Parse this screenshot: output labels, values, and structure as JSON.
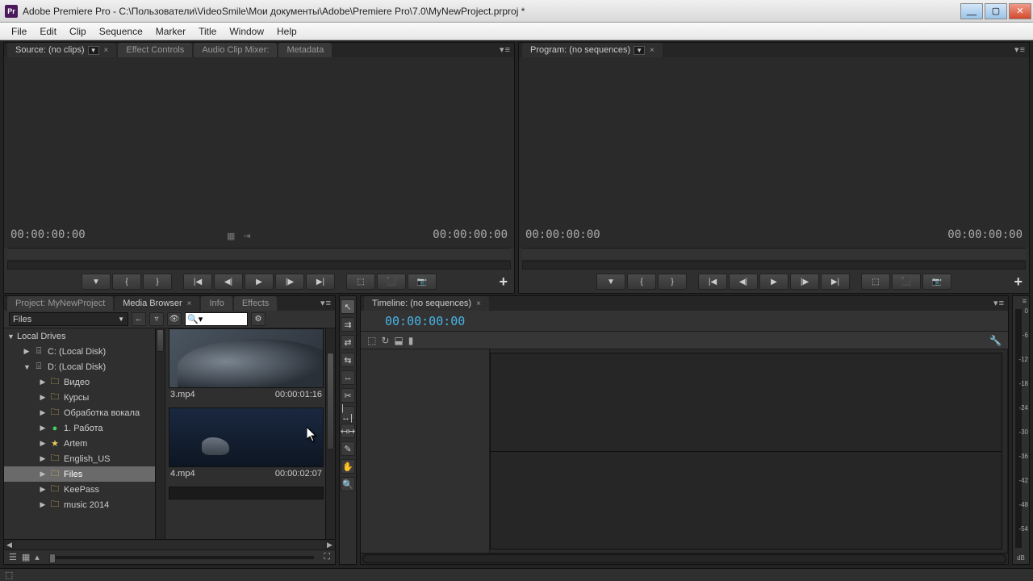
{
  "titlebar": {
    "app_icon": "Pr",
    "title": "Adobe Premiere Pro - C:\\Пользователи\\VideoSmile\\Мои документы\\Adobe\\Premiere Pro\\7.0\\MyNewProject.prproj *"
  },
  "menubar": [
    "File",
    "Edit",
    "Clip",
    "Sequence",
    "Marker",
    "Title",
    "Window",
    "Help"
  ],
  "source_panel": {
    "tabs": {
      "source": "Source: (no clips)",
      "effect_controls": "Effect Controls",
      "audio_mixer": "Audio Clip Mixer:",
      "metadata": "Metadata"
    },
    "time_left": "00:00:00:00",
    "time_right": "00:00:00:00"
  },
  "program_panel": {
    "tab": "Program: (no sequences)",
    "time_left": "00:00:00:00",
    "time_right": "00:00:00:00"
  },
  "project_panel": {
    "tabs": {
      "project": "Project: MyNewProject",
      "media_browser": "Media Browser",
      "info": "Info",
      "effects": "Effects"
    },
    "dropdown": "Files",
    "tree_root": "Local Drives",
    "tree_items": [
      {
        "label": "C: (Local Disk)",
        "icon": "disk",
        "depth": 1,
        "expand": "closed"
      },
      {
        "label": "D: (Local Disk)",
        "icon": "disk",
        "depth": 1,
        "expand": "open"
      },
      {
        "label": "Видео",
        "icon": "folder",
        "depth": 2,
        "expand": "closed"
      },
      {
        "label": "Курсы",
        "icon": "folder",
        "depth": 2,
        "expand": "closed"
      },
      {
        "label": "Обработка вокала",
        "icon": "folder",
        "depth": 2,
        "expand": "closed"
      },
      {
        "label": "1. Работа",
        "icon": "green",
        "depth": 2,
        "expand": "closed"
      },
      {
        "label": "Artem",
        "icon": "star",
        "depth": 2,
        "expand": "closed"
      },
      {
        "label": "English_US",
        "icon": "folder",
        "depth": 2,
        "expand": "closed"
      },
      {
        "label": "Files",
        "icon": "folder",
        "depth": 2,
        "expand": "closed",
        "sel": true
      },
      {
        "label": "KeePass",
        "icon": "folder",
        "depth": 2,
        "expand": "closed"
      },
      {
        "label": "music 2014",
        "icon": "folder",
        "depth": 2,
        "expand": "closed"
      }
    ],
    "clips": [
      {
        "name": "3.mp4",
        "duration": "00:00:01:16",
        "style": "car"
      },
      {
        "name": "4.mp4",
        "duration": "00:00:02:07",
        "style": "wolf"
      }
    ]
  },
  "timeline_panel": {
    "tab": "Timeline: (no sequences)",
    "timecode": "00:00:00:00"
  },
  "meter": {
    "ticks": [
      "0",
      "-6",
      "-12",
      "-18",
      "-24",
      "-30",
      "-36",
      "-42",
      "-48",
      "-54",
      ""
    ],
    "label": "dB"
  }
}
